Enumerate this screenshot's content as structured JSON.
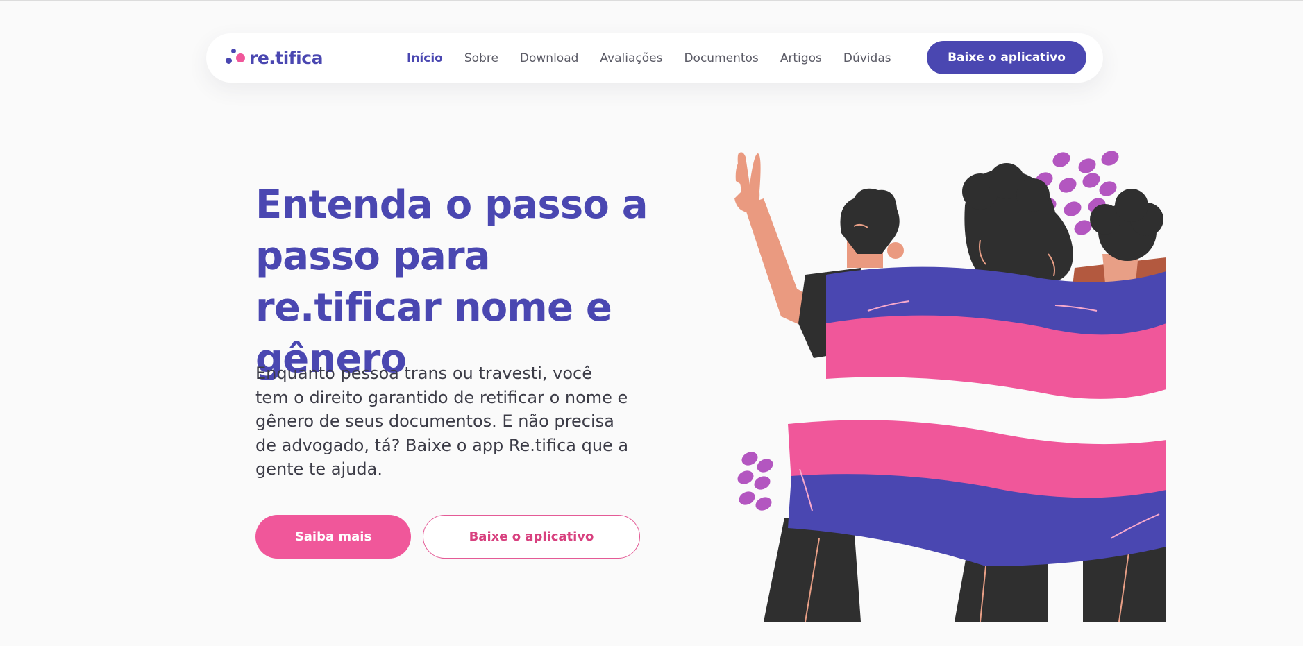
{
  "brand": {
    "name": "re.tifica",
    "colors": {
      "primary": "#4a47b1",
      "accent": "#f0579a",
      "background": "#fafafa"
    }
  },
  "nav": {
    "items": [
      {
        "label": "Início",
        "active": true
      },
      {
        "label": "Sobre",
        "active": false
      },
      {
        "label": "Download",
        "active": false
      },
      {
        "label": "Avaliações",
        "active": false
      },
      {
        "label": "Documentos",
        "active": false
      },
      {
        "label": "Artigos",
        "active": false
      },
      {
        "label": "Dúvidas",
        "active": false
      }
    ],
    "cta_label": "Baixe o aplicativo"
  },
  "hero": {
    "title": "Entenda o passo a passo para re.tificar nome e gênero",
    "text": "Enquanto pessoa trans ou travesti, você tem o direito garantido de retificar o nome e gênero de seus documentos. E não precisa de advogado, tá? Baixe o app Re.tifica que a gente te ajuda.",
    "primary_button": "Saiba mais",
    "secondary_button": "Baixe o aplicativo",
    "illustration": "people-holding-flag-illustration"
  }
}
